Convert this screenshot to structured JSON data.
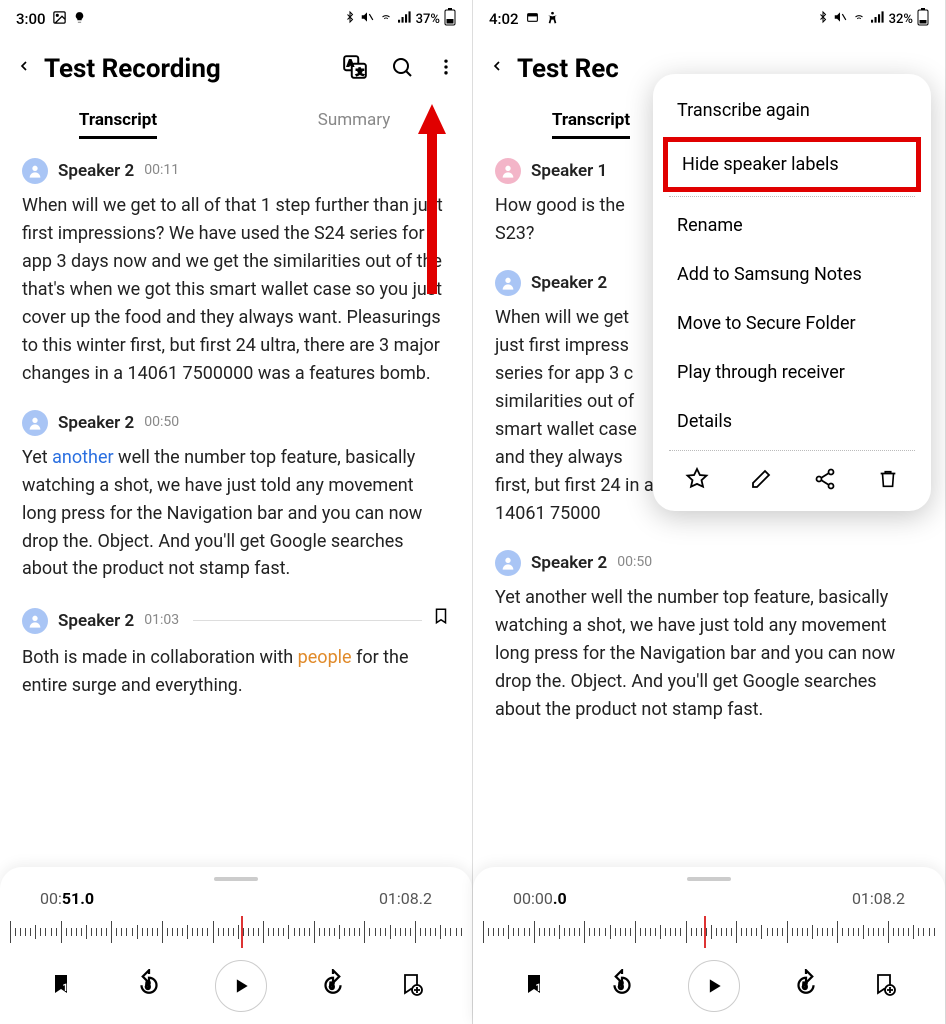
{
  "left": {
    "status": {
      "time": "3:00",
      "battery": "37%"
    },
    "title": "Test Recording",
    "tabs": {
      "transcript": "Transcript",
      "summary": "Summary"
    },
    "segments": [
      {
        "avatar": "blue",
        "speaker": "Speaker 2",
        "time": "00:11",
        "text": "When will we get to all of that 1 step further than just first impressions? We have used the S24 series for app 3 days now and we get the similarities out of the that's when we got this smart wallet case so you just cover up the food and they always want. Pleasurings to this winter first, but first 24 ultra, there are 3 major changes in a 14061 7500000 was a features bomb."
      },
      {
        "avatar": "blue",
        "speaker": "Speaker 2",
        "time": "00:50",
        "pre": "Yet ",
        "hlword": "another",
        "hlclass": "word-blue",
        "post": " well the number top feature, basically watching a shot, we have just told any movement long press for the Navigation bar and you can now drop the. Object. And you'll get Google searches about the product not stamp fast."
      },
      {
        "avatar": "blue",
        "speaker": "Speaker 2",
        "time": "01:03",
        "hasRule": true,
        "hasBookmark": true,
        "pre": "Both is made in collaboration with ",
        "hlword": "people",
        "hlclass": "word-orange",
        "post": " for the entire surge and everything."
      }
    ],
    "player": {
      "current_pre": "00:",
      "current_bold": "51.0",
      "total": "01:08.2",
      "bmCount": "1"
    }
  },
  "right": {
    "status": {
      "time": "4:02",
      "battery": "32%"
    },
    "title": "Test Rec",
    "tabs": {
      "transcript": "Transcript",
      "summary": ""
    },
    "segments": [
      {
        "avatar": "pink",
        "speaker": "Speaker 1",
        "time": "",
        "text": "How good is the S23?"
      },
      {
        "avatar": "blue",
        "speaker": "Speaker 2",
        "time": "",
        "text": "When will we get just first impress series for app 3 c similarities out of smart wallet case and they always first, but first 24 in a 14061 75000"
      },
      {
        "avatar": "blue",
        "speaker": "Speaker 2",
        "time": "00:50",
        "text": "Yet another well the number top feature, basically watching a shot, we have just told any movement long press for the Navigation bar and you can now drop the. Object. And you'll get Google searches about the product not stamp fast."
      }
    ],
    "player": {
      "current_pre": "00:00",
      "current_bold": ".0",
      "total": "01:08.2",
      "bmCount": "1"
    },
    "menu": {
      "items": {
        "transcribe": "Transcribe again",
        "hide": "Hide speaker labels",
        "rename": "Rename",
        "notes": "Add to Samsung Notes",
        "secure": "Move to Secure Folder",
        "receiver": "Play through receiver",
        "details": "Details"
      }
    }
  }
}
